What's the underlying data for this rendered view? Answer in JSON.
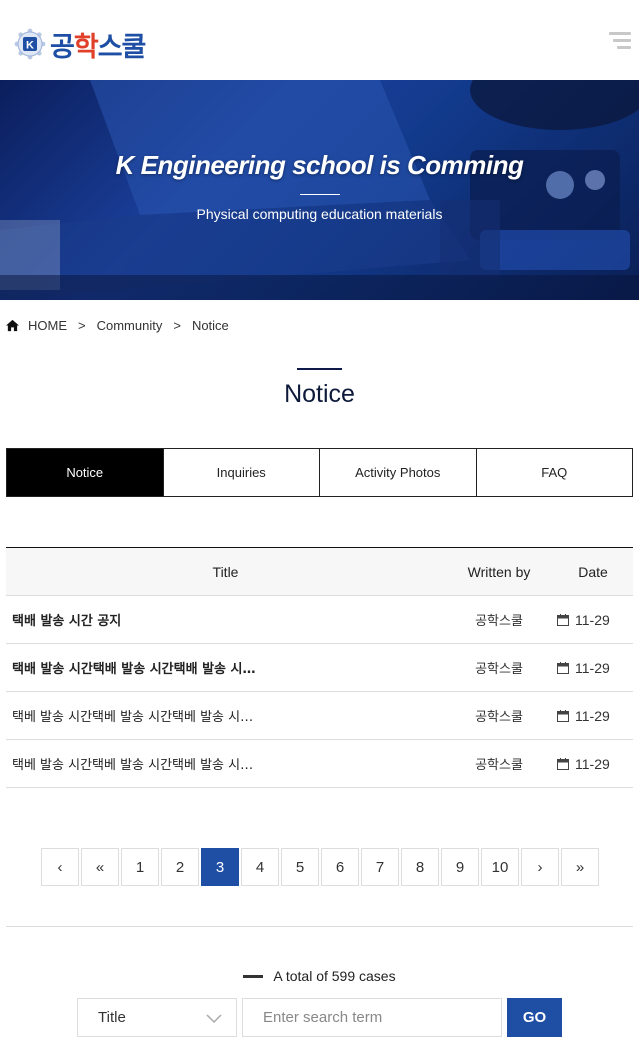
{
  "header": {
    "logo_text_part1": "공",
    "logo_text_part2": "학",
    "logo_text_part3": "스쿨",
    "logo_mark_letter": "K",
    "menu_icon": "hamburger-menu-icon"
  },
  "hero": {
    "title": "K Engineering school is Comming",
    "subtitle": "Physical computing education materials"
  },
  "breadcrumb": {
    "home": "HOME",
    "sep": ">",
    "level1": "Community",
    "level2": "Notice"
  },
  "page_title": "Notice",
  "tabs": [
    {
      "label": "Notice",
      "active": true
    },
    {
      "label": "Inquiries",
      "active": false
    },
    {
      "label": "Activity Photos",
      "active": false
    },
    {
      "label": "FAQ",
      "active": false
    }
  ],
  "table": {
    "headers": {
      "title": "Title",
      "writer": "Written by",
      "date": "Date"
    },
    "rows": [
      {
        "title": "택배 발송 시간 공지",
        "writer": "공학스쿨",
        "date": "11-29",
        "bold": true
      },
      {
        "title": "택배 발송 시간택배 발송 시간택배 발송 시…",
        "writer": "공학스쿨",
        "date": "11-29",
        "bold": true
      },
      {
        "title": "택베 발송 시간택베 발송 시간택베 발송 시…",
        "writer": "공학스쿨",
        "date": "11-29",
        "bold": false
      },
      {
        "title": "택베 발송 시간택베 발송 시간택베 발송 시…",
        "writer": "공학스쿨",
        "date": "11-29",
        "bold": false
      }
    ]
  },
  "pagination": {
    "prev": "‹",
    "first": "«",
    "pages": [
      "1",
      "2",
      "3",
      "4",
      "5",
      "6",
      "7",
      "8",
      "9",
      "10"
    ],
    "current": "3",
    "next": "›",
    "last": "»"
  },
  "total_text": "A total of 599 cases",
  "search": {
    "select_value": "Title",
    "placeholder": "Enter search term",
    "button": "GO"
  },
  "colors": {
    "brand_blue": "#1e4fa5",
    "brand_red": "#e0402a",
    "active_tab": "#000000"
  }
}
